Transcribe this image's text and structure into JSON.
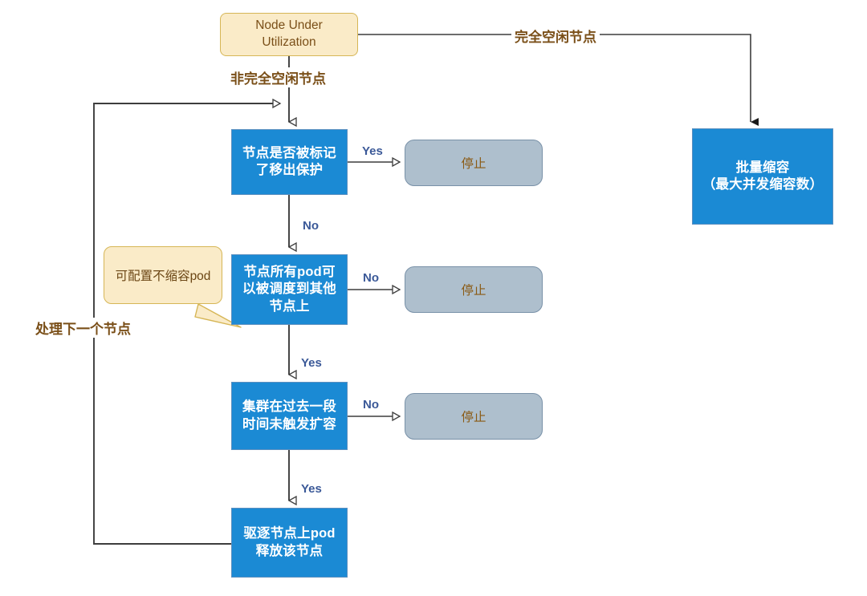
{
  "diagram": {
    "title_node": {
      "label_line1": "Node Under",
      "label_line2": "Utilization"
    },
    "nodes": [
      {
        "id": "start",
        "type": "start",
        "label": "Node Under\nUtilization"
      },
      {
        "id": "decision-taint",
        "type": "process",
        "label_line1": "节点是否被标记",
        "label_line2": "了移出保护"
      },
      {
        "id": "decision-pods",
        "type": "process",
        "label_line1": "节点所有pod可",
        "label_line2": "以被调度到其他",
        "label_line3": "节点上"
      },
      {
        "id": "decision-scaleup",
        "type": "process",
        "label_line1": "集群在过去一段",
        "label_line2": "时间未触发扩容"
      },
      {
        "id": "evict",
        "type": "process",
        "label_line1": "驱逐节点上pod",
        "label_line2": "释放该节点"
      },
      {
        "id": "batch-scaledown",
        "type": "process",
        "label_line1": "批量缩容",
        "label_line2": "（最大并发缩容数）"
      },
      {
        "id": "stop-1",
        "type": "stop",
        "label": "停止"
      },
      {
        "id": "stop-2",
        "type": "stop",
        "label": "停止"
      },
      {
        "id": "stop-3",
        "type": "stop",
        "label": "停止"
      }
    ],
    "edge_labels": {
      "idle_full": "完全空闲节点",
      "idle_partial": "非完全空闲节点",
      "taint_yes": "Yes",
      "taint_no": "No",
      "pods_no": "No",
      "pods_yes": "Yes",
      "scaleup_no": "No",
      "scaleup_yes": "Yes",
      "next_node": "处理下一个节点"
    },
    "callout": {
      "label": "可配置不缩容pod"
    },
    "colors": {
      "process_fill": "#1b8ad4",
      "process_border": "#5b8fbf",
      "start_fill": "#faebc8",
      "start_border": "#d6b656",
      "stop_fill": "#aebfcd",
      "stop_border": "#7991a8",
      "edge_line": "#3d3d3d",
      "edge_label_text": "#3b5998",
      "flow_label_text": "#7a4f18",
      "stop_text": "#8a5a14",
      "process_text": "#ffffff"
    }
  }
}
